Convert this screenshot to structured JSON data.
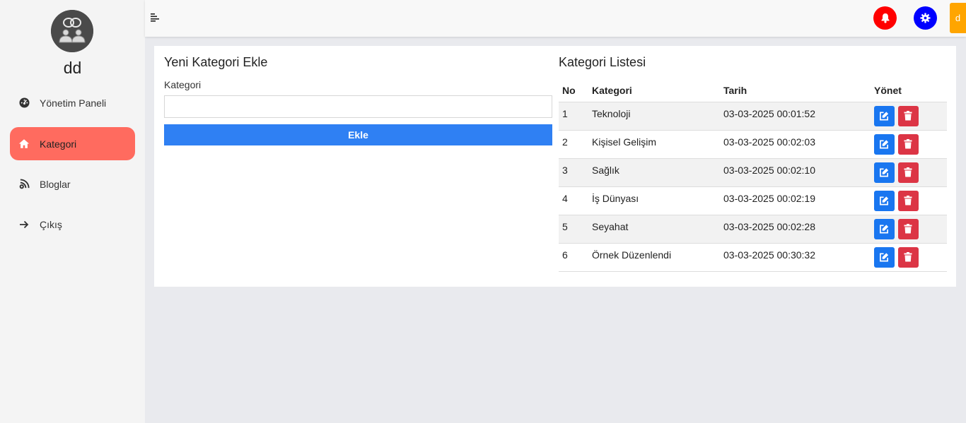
{
  "sidebar": {
    "username": "dd",
    "items": [
      {
        "label": "Yönetim Paneli",
        "icon": "gauge-icon"
      },
      {
        "label": "Kategori",
        "icon": "home-icon",
        "active": true
      },
      {
        "label": "Bloglar",
        "icon": "rss-icon"
      },
      {
        "label": "Çıkış",
        "icon": "arrow-right-icon"
      }
    ]
  },
  "topbar": {
    "user_initial": "d",
    "colors": {
      "bell": "#ff0000",
      "gear": "#0000ff",
      "user": "#ffa500"
    }
  },
  "form": {
    "title": "Yeni Kategori Ekle",
    "label": "Kategori",
    "value": "",
    "button": "Ekle"
  },
  "list": {
    "title": "Kategori Listesi",
    "headers": {
      "no": "No",
      "category": "Kategori",
      "date": "Tarih",
      "manage": "Yönet"
    },
    "rows": [
      {
        "no": "1",
        "category": "Teknoloji",
        "date": "03-03-2025 00:01:52"
      },
      {
        "no": "2",
        "category": "Kişisel Gelişim",
        "date": "03-03-2025 00:02:03"
      },
      {
        "no": "3",
        "category": "Sağlık",
        "date": "03-03-2025 00:02:10"
      },
      {
        "no": "4",
        "category": "İş Dünyası",
        "date": "03-03-2025 00:02:19"
      },
      {
        "no": "5",
        "category": "Seyahat",
        "date": "03-03-2025 00:02:28"
      },
      {
        "no": "6",
        "category": "Örnek Düzenlendi",
        "date": "03-03-2025 00:30:32"
      }
    ]
  }
}
